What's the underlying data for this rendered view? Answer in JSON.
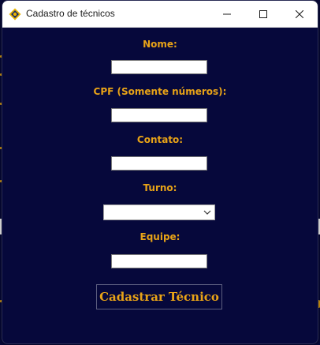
{
  "window": {
    "title": "Cadastro de técnicos",
    "app_icon": "gear-app-icon",
    "controls": {
      "minimize_icon": "minimize-icon",
      "maximize_icon": "maximize-icon",
      "close_icon": "close-icon"
    }
  },
  "form": {
    "nome": {
      "label": "Nome:",
      "value": ""
    },
    "cpf": {
      "label": "CPF (Somente números):",
      "value": ""
    },
    "contato": {
      "label": "Contato:",
      "value": ""
    },
    "turno": {
      "label": "Turno:",
      "selected": ""
    },
    "equipe": {
      "label": "Equipe:",
      "value": ""
    },
    "submit_label": "Cadastrar Técnico"
  },
  "colors": {
    "background": "#06083b",
    "label": "#e8a317",
    "titlebar": "#ffffff"
  }
}
